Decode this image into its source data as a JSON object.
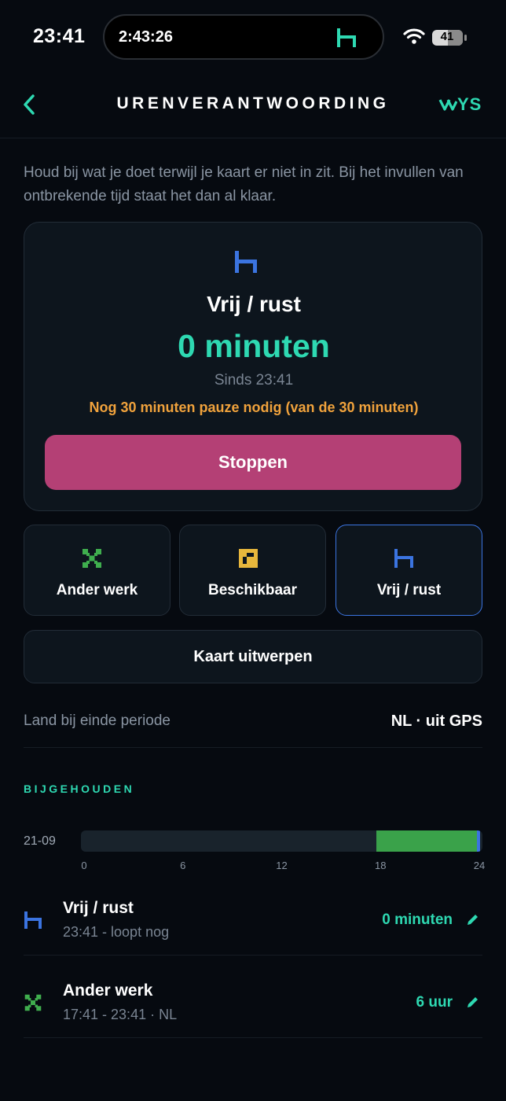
{
  "status_bar": {
    "time": "23:41",
    "timer": "2:43:26",
    "battery": "41"
  },
  "header": {
    "title": "URENVERANTWOORDING",
    "brand": "YS"
  },
  "intro": "Houd bij wat je doet terwijl je kaart er niet in zit. Bij het invullen van ontbrekende tijd staat het dan al klaar.",
  "current": {
    "activity": "Vrij / rust",
    "duration": "0 minuten",
    "since": "Sinds 23:41",
    "pause_note": "Nog 30 minuten pauze nodig (van de 30 minuten)",
    "stop_label": "Stoppen"
  },
  "activities": [
    {
      "label": "Ander werk",
      "icon": "hammers-icon",
      "color": "#3fae4e"
    },
    {
      "label": "Beschikbaar",
      "icon": "available-icon",
      "color": "#e8b73c"
    },
    {
      "label": "Vrij / rust",
      "icon": "bed-icon",
      "color": "#3b74e0",
      "selected": true
    }
  ],
  "eject_label": "Kaart uitwerpen",
  "land": {
    "label": "Land bij einde periode",
    "value": "NL · uit GPS"
  },
  "section_title": "BIJGEHOUDEN",
  "timeline": {
    "date": "21-09",
    "ticks": [
      "0",
      "6",
      "12",
      "18",
      "24"
    ],
    "axis_max_hours": 24,
    "segments": [
      {
        "activity": "Ander werk",
        "start_hours": 17.68,
        "end_hours": 23.68,
        "color": "#3aa24a"
      },
      {
        "activity": "Vrij / rust",
        "start_hours": 23.68,
        "end_hours": 23.85,
        "color": "#3b74e0"
      }
    ]
  },
  "entries": [
    {
      "title": "Vrij / rust",
      "subtitle": "23:41 - loopt nog",
      "duration": "0 minuten",
      "icon": "bed-icon"
    },
    {
      "title": "Ander werk",
      "subtitle": "17:41 - 23:41 · NL",
      "duration": "6 uur",
      "icon": "hammers-icon"
    }
  ],
  "colors": {
    "accent": "#2ed9b2",
    "stop": "#b44075",
    "warning": "#f0a23c",
    "rest": "#3b74e0",
    "work": "#3fae4e",
    "available": "#e8b73c"
  }
}
